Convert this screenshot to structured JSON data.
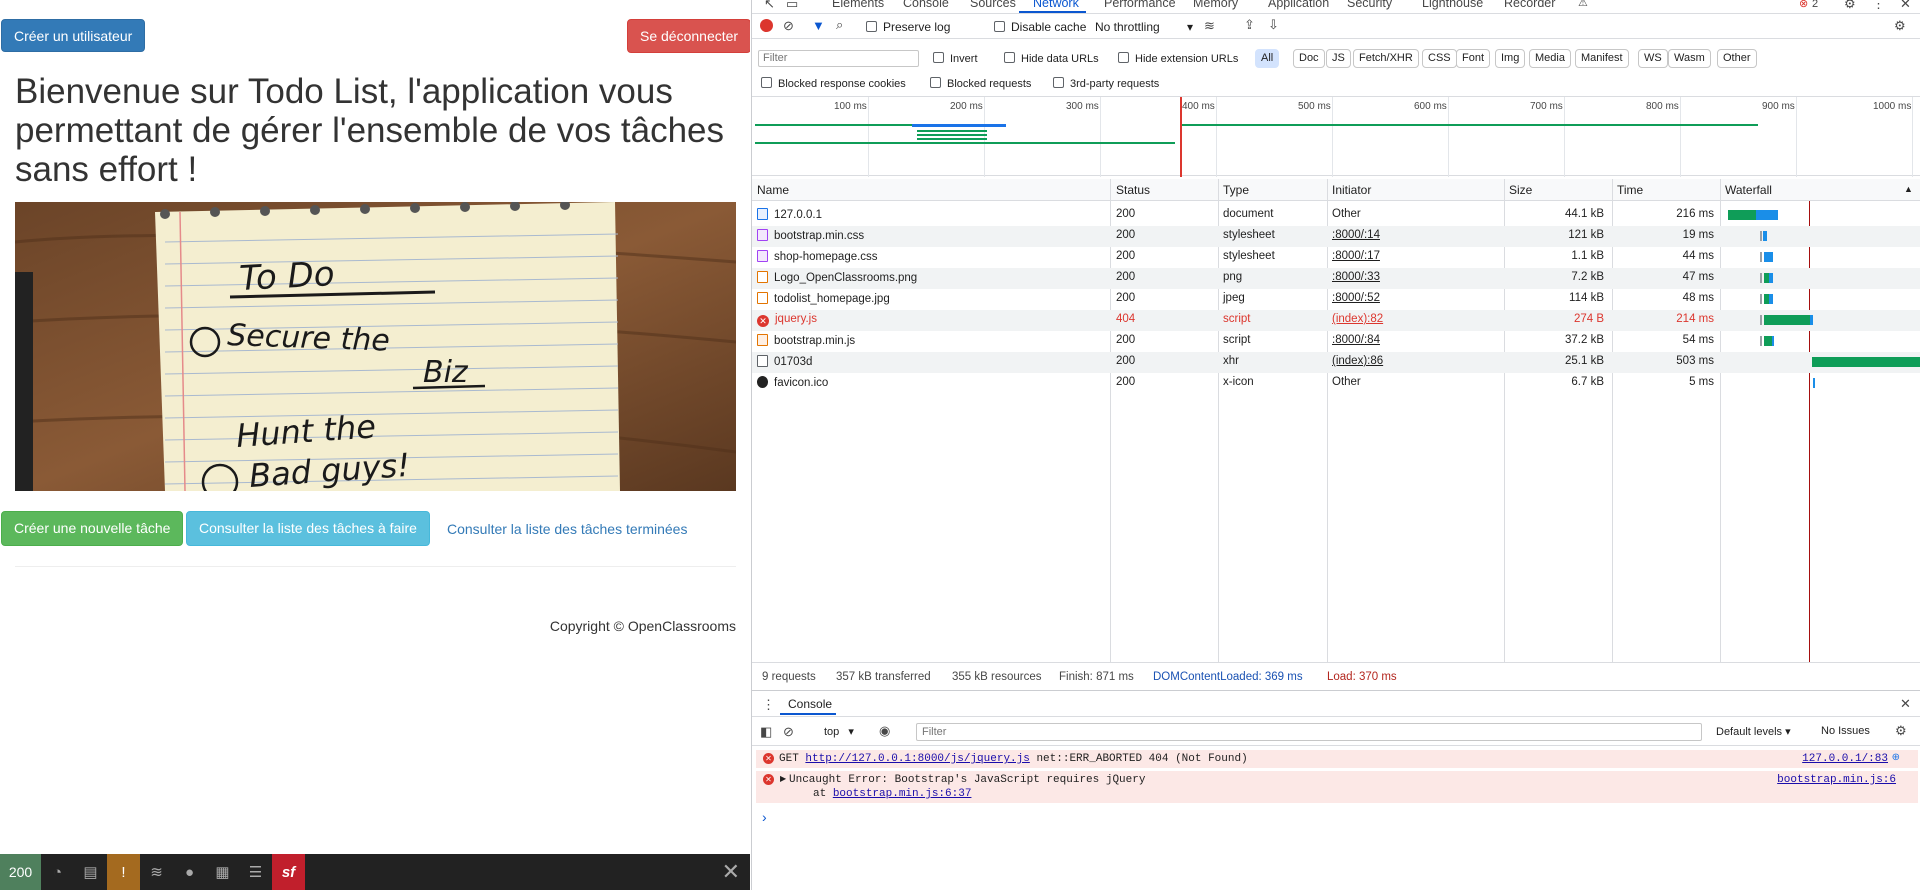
{
  "app": {
    "create_user_label": "Créer un utilisateur",
    "logout_label": "Se déconnecter",
    "welcome_text": "Bienvenue sur Todo List, l'application vous permettant de gérer l'ensemble de vos tâches sans effort !",
    "hero_note_line1": "To Do",
    "hero_note_line2": "Secure the",
    "hero_note_line3": "Biz",
    "hero_note_line4": "Hunt the",
    "hero_note_line5": "Bad guys!",
    "actions": {
      "new_task": "Créer une nouvelle tâche",
      "todo_list": "Consulter la liste des tâches à faire",
      "done_list": "Consulter la liste des tâches terminées"
    },
    "copyright": "Copyright © OpenClassrooms"
  },
  "symfony_toolbar": {
    "status_code": "200",
    "icons": [
      "timer-icon",
      "memory-icon",
      "alert-icon",
      "layers-icon",
      "user-icon",
      "form-icon",
      "database-icon",
      "symfony-icon"
    ],
    "logo_text": "sf",
    "colors": {
      "status": "#4f805d",
      "alert": "#a46a1f",
      "logo": "#c11f2c"
    }
  },
  "devtools": {
    "tabs": [
      "Elements",
      "Console",
      "Sources",
      "Network",
      "Performance",
      "Memory",
      "Application",
      "Security",
      "Lighthouse",
      "Recorder"
    ],
    "active_tab": "Network",
    "error_count": "2",
    "toolbar": {
      "preserve_log": "Preserve log",
      "disable_cache": "Disable cache",
      "throttling": "No throttling"
    },
    "filter": {
      "placeholder": "Filter",
      "invert": "Invert",
      "hide_data_urls": "Hide data URLs",
      "hide_extension_urls": "Hide extension URLs",
      "types": [
        "All",
        "Doc",
        "JS",
        "Fetch/XHR",
        "CSS",
        "Font",
        "Img",
        "Media",
        "Manifest",
        "WS",
        "Wasm",
        "Other"
      ],
      "active_type": "All",
      "blocked_cookies": "Blocked response cookies",
      "blocked_requests": "Blocked requests",
      "third_party": "3rd-party requests"
    },
    "overview_ticks": [
      "100 ms",
      "200 ms",
      "300 ms",
      "400 ms",
      "500 ms",
      "600 ms",
      "700 ms",
      "800 ms",
      "900 ms",
      "1000 ms"
    ],
    "columns": [
      "Name",
      "Status",
      "Type",
      "Initiator",
      "Size",
      "Time",
      "Waterfall"
    ],
    "requests": [
      {
        "name": "127.0.0.1",
        "status": "200",
        "type": "document",
        "initiator": "Other",
        "size": "44.1 kB",
        "time": "216 ms",
        "icon": "document-icon",
        "error": false
      },
      {
        "name": "bootstrap.min.css",
        "status": "200",
        "type": "stylesheet",
        "initiator": ":8000/:14",
        "size": "121 kB",
        "time": "19 ms",
        "icon": "stylesheet-icon",
        "error": false
      },
      {
        "name": "shop-homepage.css",
        "status": "200",
        "type": "stylesheet",
        "initiator": ":8000/:17",
        "size": "1.1 kB",
        "time": "44 ms",
        "icon": "stylesheet-icon",
        "error": false
      },
      {
        "name": "Logo_OpenClassrooms.png",
        "status": "200",
        "type": "png",
        "initiator": ":8000/:33",
        "size": "7.2 kB",
        "time": "47 ms",
        "icon": "image-icon",
        "error": false
      },
      {
        "name": "todolist_homepage.jpg",
        "status": "200",
        "type": "jpeg",
        "initiator": ":8000/:52",
        "size": "114 kB",
        "time": "48 ms",
        "icon": "image-icon",
        "error": false
      },
      {
        "name": "jquery.js",
        "status": "404",
        "type": "script",
        "initiator": "(index):82",
        "size": "274 B",
        "time": "214 ms",
        "icon": "error-icon",
        "error": true
      },
      {
        "name": "bootstrap.min.js",
        "status": "200",
        "type": "script",
        "initiator": ":8000/:84",
        "size": "37.2 kB",
        "time": "54 ms",
        "icon": "script-icon",
        "error": false
      },
      {
        "name": "01703d",
        "status": "200",
        "type": "xhr",
        "initiator": "(index):86",
        "size": "25.1 kB",
        "time": "503 ms",
        "icon": "file-icon",
        "error": false
      },
      {
        "name": "favicon.ico",
        "status": "200",
        "type": "x-icon",
        "initiator": "Other",
        "size": "6.7 kB",
        "time": "5 ms",
        "icon": "symfony-icon",
        "error": false
      }
    ],
    "summary": {
      "requests": "9 requests",
      "transferred": "357 kB transferred",
      "resources": "355 kB resources",
      "finish": "Finish: 871 ms",
      "dom_loaded": "DOMContentLoaded: 369 ms",
      "load": "Load: 370 ms"
    },
    "console": {
      "tab_label": "Console",
      "context": "top",
      "filter_placeholder": "Filter",
      "levels": "Default levels",
      "issues": "No Issues",
      "messages": [
        {
          "prefix": "GET ",
          "url": "http://127.0.0.1:8000/js/jquery.js",
          "text": " net::ERR_ABORTED 404 (Not Found)",
          "source": "127.0.0.1/:83"
        },
        {
          "text": "Uncaught Error: Bootstrap's JavaScript requires jQuery",
          "at_prefix": "at ",
          "at_link": "bootstrap.min.js:6:37",
          "source": "bootstrap.min.js:6"
        }
      ],
      "prompt": "›"
    }
  }
}
